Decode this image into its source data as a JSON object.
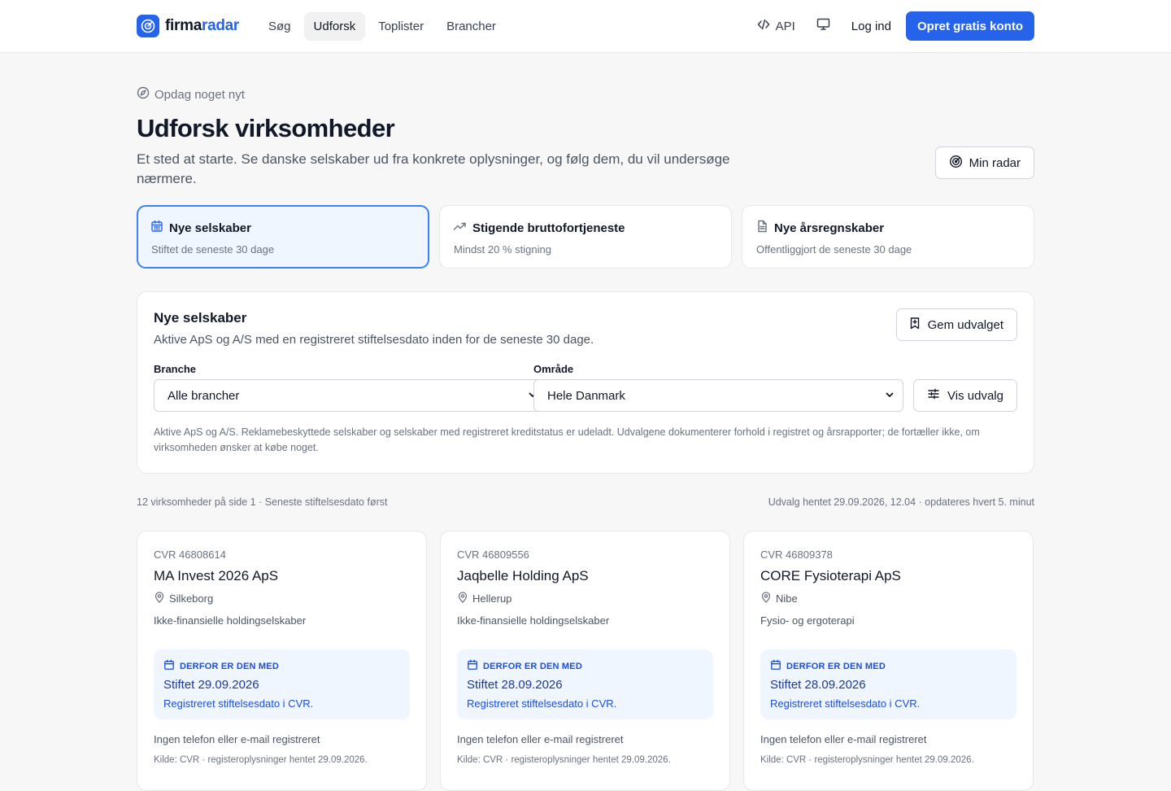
{
  "header": {
    "logo_part1": "firma",
    "logo_part2": "radar",
    "nav": [
      {
        "label": "Søg"
      },
      {
        "label": "Udforsk"
      },
      {
        "label": "Toplister"
      },
      {
        "label": "Brancher"
      }
    ],
    "active_nav": "Udforsk",
    "api_label": "API",
    "login_label": "Log ind",
    "cta_label": "Opret gratis konto"
  },
  "hero": {
    "eyebrow": "Opdag noget nyt",
    "title": "Udforsk virksomheder",
    "intro": "Et sted at starte. Se danske selskaber ud fra konkrete oplysninger, og følg dem, du vil undersøge nærmere.",
    "radar_button": "Min radar"
  },
  "filters": [
    {
      "title": "Nye selskaber",
      "subtitle": "Stiftet de seneste 30 dage",
      "icon": "calendar-icon",
      "active": true
    },
    {
      "title": "Stigende bruttofortjeneste",
      "subtitle": "Mindst 20 % stigning",
      "icon": "trending-up-icon",
      "active": false
    },
    {
      "title": "Nye årsregnskaber",
      "subtitle": "Offentliggjort de seneste 30 dage",
      "icon": "document-icon",
      "active": false
    }
  ],
  "panel": {
    "title": "Nye selskaber",
    "subtitle": "Aktive ApS og A/S med en registreret stiftelsesdato inden for de seneste 30 dage.",
    "save_button": "Gem udvalget",
    "branche_label": "Branche",
    "branche_value": "Alle brancher",
    "omraade_label": "Område",
    "omraade_value": "Hele Danmark",
    "show_button": "Vis udvalg",
    "note": "Aktive ApS og A/S. Reklamebeskyttede selskaber og selskaber med registreret kreditstatus er udeladt. Udvalgene dokumenterer forhold i registret og årsrapporter; de fortæller ikke, om virksomheden ønsker at købe noget."
  },
  "results": {
    "count_text": "12 virksomheder på side 1 · Seneste stiftelsesdato først",
    "fetched_text": "Udvalg hentet 29.09.2026, 12.04 · opdateres hvert 5. minut"
  },
  "companies": [
    {
      "cvr": "CVR 46808614",
      "name": "MA Invest 2026 ApS",
      "city": "Silkeborg",
      "industry": "Ikke-finansielle holdingselskaber",
      "reason_label": "DERFOR ER DEN MED",
      "reason_date": "Stiftet 29.09.2026",
      "reason_note": "Registreret stiftelsesdato i CVR.",
      "contact": "Ingen telefon eller e-mail registreret",
      "source": "Kilde: CVR · registeroplysninger hentet 29.09.2026."
    },
    {
      "cvr": "CVR 46809556",
      "name": "Jaqbelle Holding ApS",
      "city": "Hellerup",
      "industry": "Ikke-finansielle holdingselskaber",
      "reason_label": "DERFOR ER DEN MED",
      "reason_date": "Stiftet 28.09.2026",
      "reason_note": "Registreret stiftelsesdato i CVR.",
      "contact": "Ingen telefon eller e-mail registreret",
      "source": "Kilde: CVR · registeroplysninger hentet 29.09.2026."
    },
    {
      "cvr": "CVR 46809378",
      "name": "CORE Fysioterapi ApS",
      "city": "Nibe",
      "industry": "Fysio- og ergoterapi",
      "reason_label": "DERFOR ER DEN MED",
      "reason_date": "Stiftet 28.09.2026",
      "reason_note": "Registreret stiftelsesdato i CVR.",
      "contact": "Ingen telefon eller e-mail registreret",
      "source": "Kilde: CVR · registeroplysninger hentet 29.09.2026."
    }
  ],
  "colors": {
    "brand": "#2563eb",
    "active_card_bg": "#eff6ff",
    "active_card_border": "#3b82f6",
    "reason_bg": "#eff6ff",
    "page_bg": "#f7f7f7"
  }
}
